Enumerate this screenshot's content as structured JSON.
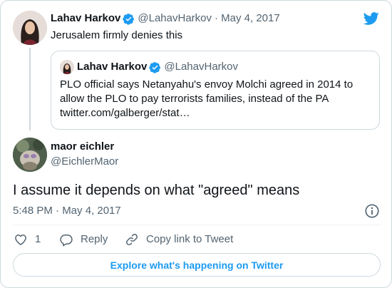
{
  "parent_tweet": {
    "name": "Lahav Harkov",
    "handle": "@LahavHarkov",
    "date": "· May 4, 2017",
    "text": "Jerusalem firmly denies this"
  },
  "quoted_tweet": {
    "name": "Lahav Harkov",
    "handle": "@LahavHarkov",
    "lines": [
      "PLO official says Netanyahu's envoy Molchi agreed in 2014 to",
      "allow the PLO to pay terrorists families, instead of the PA",
      "twitter.com/galberger/stat…"
    ]
  },
  "main_tweet": {
    "name": "maor eichler",
    "handle": "@EichlerMaor",
    "text": "I assume it depends on what \"agreed\" means",
    "timestamp": "5:48 PM · May 4, 2017"
  },
  "actions": {
    "like_count": "1",
    "reply_label": "Reply",
    "copy_label": "Copy link to Tweet"
  },
  "explore_label": "Explore what's happening on Twitter",
  "icons": {
    "brand": "twitter-bird-icon",
    "verified": "verified-badge-icon",
    "info": "info-icon",
    "like": "heart-icon",
    "reply": "reply-bubble-icon",
    "copy": "link-icon"
  },
  "colors": {
    "twitter_blue": "#1d9bf0",
    "text": "#0f1419",
    "muted": "#536471",
    "border": "#cfd9de"
  }
}
